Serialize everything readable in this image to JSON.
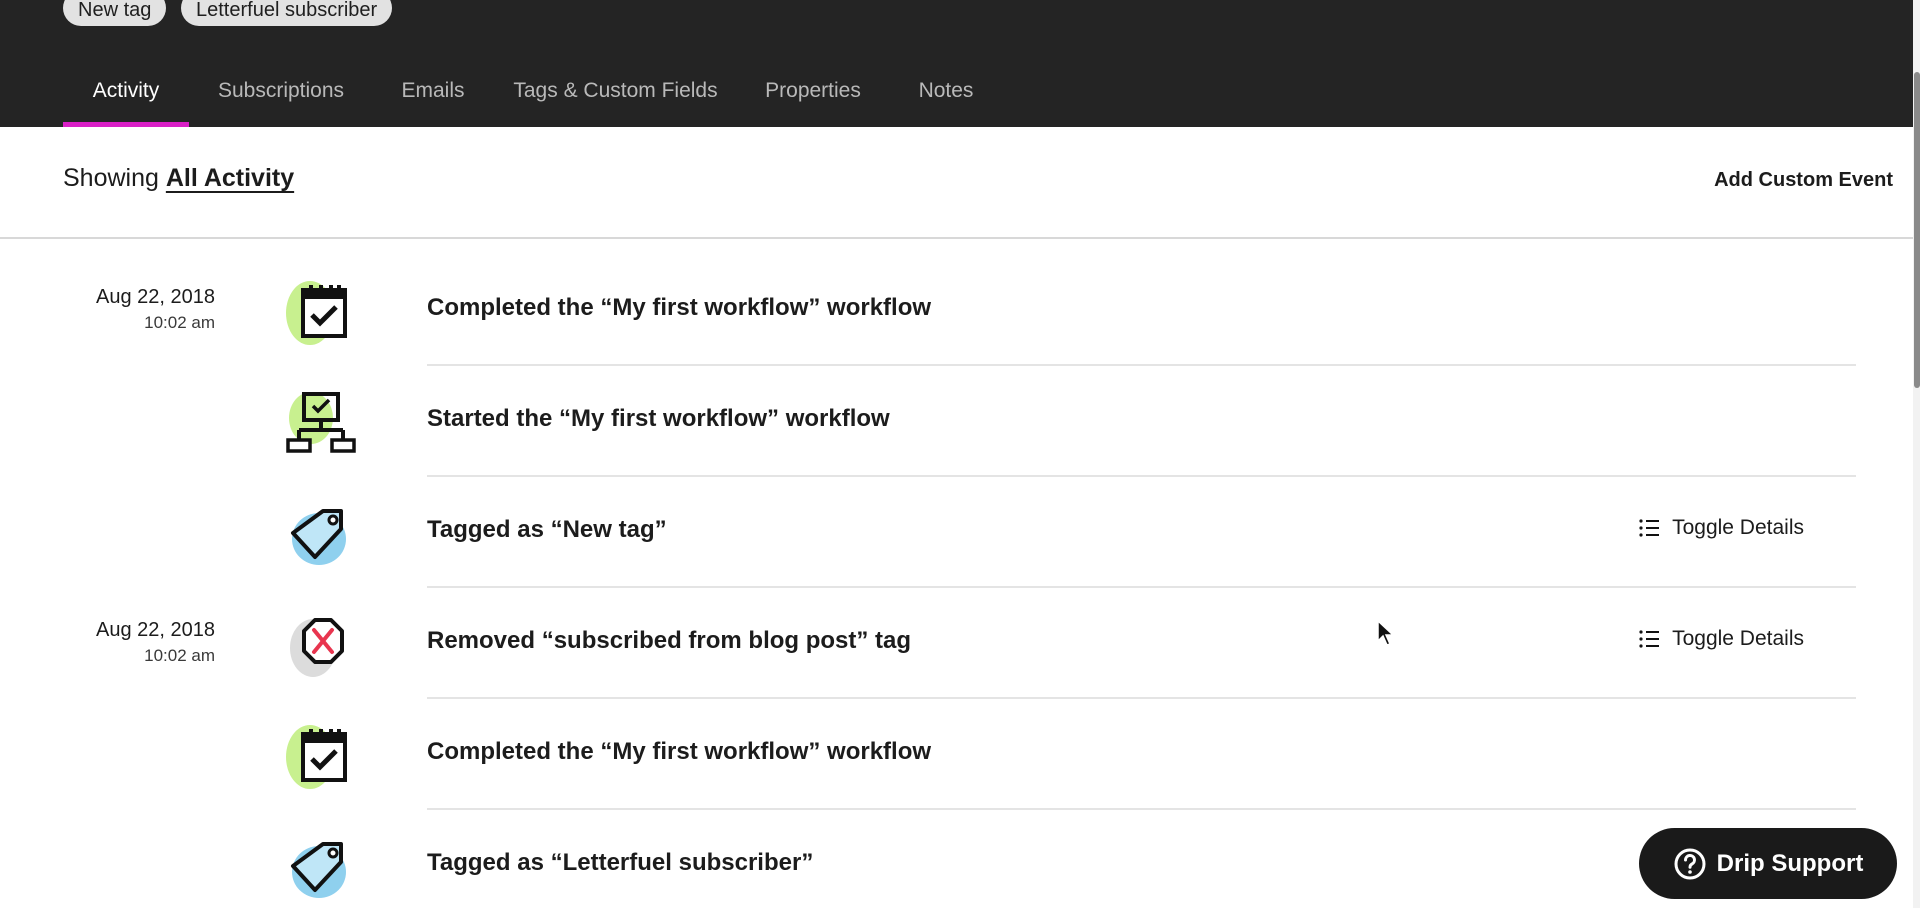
{
  "header": {
    "tags": [
      "New tag",
      "Letterfuel subscriber"
    ],
    "tabs": [
      {
        "label": "Activity",
        "active": true
      },
      {
        "label": "Subscriptions",
        "active": false
      },
      {
        "label": "Emails",
        "active": false
      },
      {
        "label": "Tags & Custom Fields",
        "active": false
      },
      {
        "label": "Properties",
        "active": false
      },
      {
        "label": "Notes",
        "active": false
      }
    ],
    "accent_color": "#d91fc6"
  },
  "filter": {
    "prefix": "Showing",
    "value": "All Activity",
    "add_custom_event_label": "Add Custom Event"
  },
  "activity": [
    {
      "date": "Aug 22, 2018",
      "time": "10:02 am",
      "icon": "calendar-check-icon",
      "title": "Completed the “My first workflow” workflow",
      "toggle": ""
    },
    {
      "date": "",
      "time": "",
      "icon": "workflow-icon",
      "title": "Started the “My first workflow” workflow",
      "toggle": ""
    },
    {
      "date": "",
      "time": "",
      "icon": "tag-icon",
      "title": "Tagged as “New tag”",
      "toggle": "Toggle Details"
    },
    {
      "date": "Aug 22, 2018",
      "time": "10:02 am",
      "icon": "remove-tag-icon",
      "title": "Removed “subscribed from blog post” tag",
      "toggle": "Toggle Details"
    },
    {
      "date": "",
      "time": "",
      "icon": "calendar-check-icon",
      "title": "Completed the “My first workflow” workflow",
      "toggle": ""
    },
    {
      "date": "",
      "time": "",
      "icon": "tag-icon",
      "title": "Tagged as “Letterfuel subscriber”",
      "toggle": ""
    }
  ],
  "support": {
    "label": "Drip Support"
  }
}
